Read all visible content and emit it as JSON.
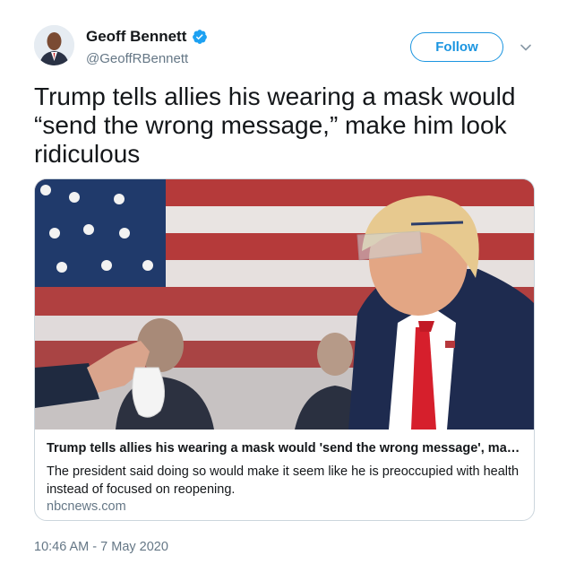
{
  "author": {
    "name": "Geoff Bennett",
    "handle": "@GeoffRBennett",
    "verified_icon": "verified-badge-icon",
    "avatar_icon": "avatar"
  },
  "actions": {
    "follow_label": "Follow",
    "more_icon": "chevron-down-icon"
  },
  "tweet": {
    "text": "Trump tells allies his wearing a mask would “send the wrong message,” make him look ridiculous",
    "timestamp": "10:46 AM - 7 May 2020"
  },
  "card": {
    "title": "Trump tells allies his wearing a mask would 'send the wrong message', make...",
    "description": "The president said doing so would make it seem like he is preoccupied with health instead of focused on reopening.",
    "domain": "nbcnews.com"
  },
  "colors": {
    "accent": "#1b95e0",
    "secondary_text": "#657786",
    "border": "#ccd6dd"
  }
}
